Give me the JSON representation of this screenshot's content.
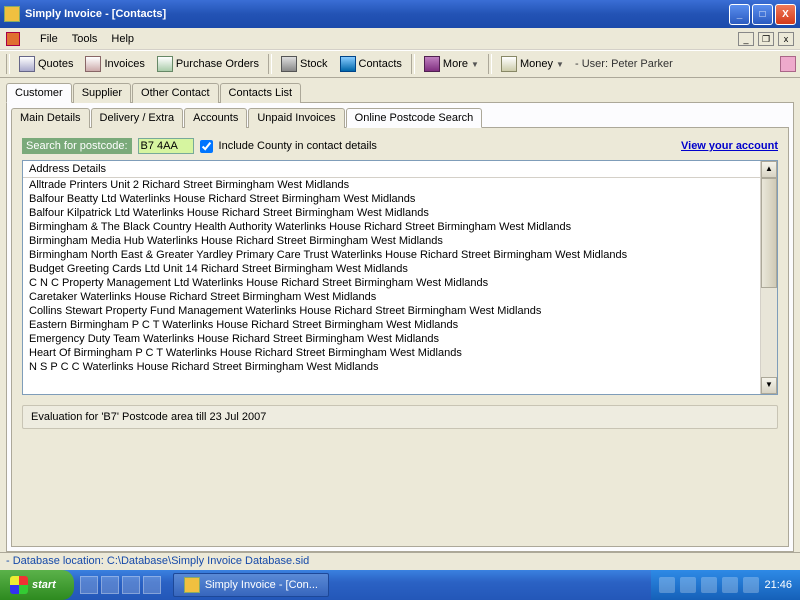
{
  "window": {
    "title": "Simply Invoice - [Contacts]"
  },
  "menu": {
    "file": "File",
    "tools": "Tools",
    "help": "Help"
  },
  "toolbar": {
    "quotes": "Quotes",
    "invoices": "Invoices",
    "purchase_orders": "Purchase Orders",
    "stock": "Stock",
    "contacts": "Contacts",
    "more": "More",
    "money": "Money",
    "user_label": "- User: Peter Parker"
  },
  "tabs1": {
    "customer": "Customer",
    "supplier": "Supplier",
    "other": "Other Contact",
    "list": "Contacts List"
  },
  "tabs2": {
    "main": "Main Details",
    "delivery": "Delivery / Extra",
    "accounts": "Accounts",
    "unpaid": "Unpaid Invoices",
    "postcode": "Online Postcode Search"
  },
  "search": {
    "label": "Search for postcode:",
    "value": "B7 4AA",
    "include_county": "Include County in contact details",
    "view_account": "View your account"
  },
  "address_list": {
    "header": "Address Details",
    "rows": [
      "Alltrade Printers Unit 2  Richard Street Birmingham West Midlands",
      "Balfour Beatty Ltd Waterlinks House  Richard Street Birmingham West Midlands",
      "Balfour Kilpatrick Ltd Waterlinks House  Richard Street Birmingham West Midlands",
      "Birmingham & The Black Country Health Authority Waterlinks House  Richard Street Birmingham West Midlands",
      "Birmingham Media Hub Waterlinks House  Richard Street Birmingham West Midlands",
      "Birmingham North East & Greater Yardley Primary Care Trust Waterlinks House  Richard Street Birmingham West Midlands",
      "Budget Greeting Cards Ltd Unit 14  Richard Street Birmingham West Midlands",
      "C N C Property Management Ltd Waterlinks House  Richard Street Birmingham West Midlands",
      "Caretaker Waterlinks House  Richard Street Birmingham West Midlands",
      "Collins Stewart Property Fund Management Waterlinks House  Richard Street Birmingham West Midlands",
      "Eastern Birmingham P C T Waterlinks House  Richard Street Birmingham West Midlands",
      "Emergency Duty Team Waterlinks House  Richard Street Birmingham West Midlands",
      "Heart Of Birmingham P C T Waterlinks House  Richard Street Birmingham West Midlands",
      "N S P C C Waterlinks House  Richard Street Birmingham West Midlands"
    ]
  },
  "evaluation": "Evaluation for 'B7' Postcode area till 23 Jul 2007",
  "statusbar": "- Database location: C:\\Database\\Simply Invoice Database.sid",
  "taskbar": {
    "start": "start",
    "task": "Simply Invoice - [Con...",
    "clock": "21:46"
  }
}
